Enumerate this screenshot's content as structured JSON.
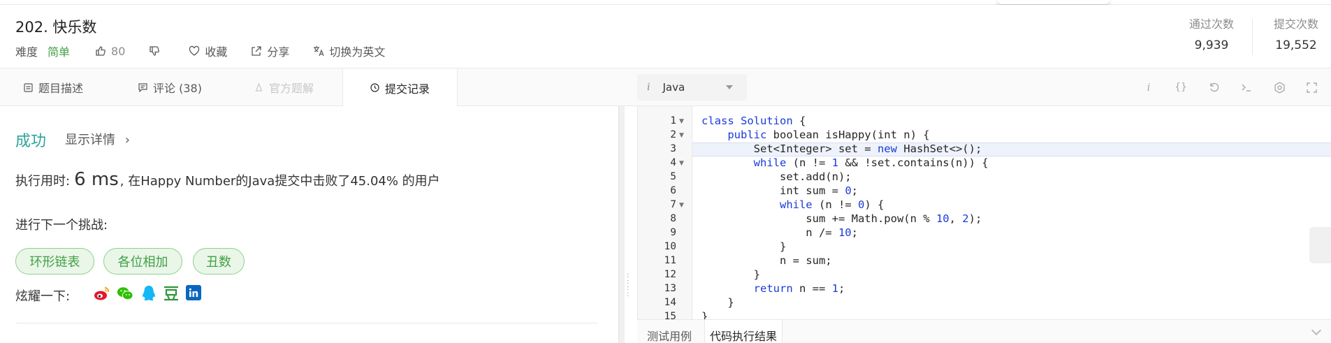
{
  "header": {
    "title": "202. 快乐数",
    "difficulty_label": "难度",
    "difficulty_value": "简单",
    "likes": "80",
    "favorite_label": "收藏",
    "share_label": "分享",
    "translate_label": "切换为英文",
    "stats": [
      {
        "label": "通过次数",
        "value": "9,939"
      },
      {
        "label": "提交次数",
        "value": "19,552"
      }
    ]
  },
  "tabs": [
    {
      "label": "题目描述",
      "icon": "description-icon",
      "state": "normal"
    },
    {
      "label": "评论 (38)",
      "icon": "comment-icon",
      "state": "normal"
    },
    {
      "label": "官方题解",
      "icon": "solution-icon",
      "state": "disabled"
    },
    {
      "label": "提交记录",
      "icon": "clock-icon",
      "state": "active"
    }
  ],
  "editor_toolbar": {
    "language": "Java",
    "icons": [
      "info-icon",
      "braces-icon",
      "reset-icon",
      "console-icon",
      "settings-icon",
      "fullscreen-icon"
    ]
  },
  "result": {
    "status": "成功",
    "details_link": "显示详情",
    "runtime_prefix": "执行用时:",
    "runtime_value": "6 ms",
    "runtime_suffix": ", 在Happy Number的Java提交中击败了45.04% 的用户",
    "challenge_label": "进行下一个挑战:",
    "challenge_tags": [
      "环形链表",
      "各位相加",
      "丑数"
    ],
    "share_label": "炫耀一下:",
    "share_icons": [
      "weibo-icon",
      "wechat-icon",
      "qq-icon",
      "douban-icon",
      "linkedin-icon"
    ],
    "colors": {
      "success": "#2ea39b",
      "tag_text": "#43a047",
      "tag_bg": "#e9f6e8",
      "keyword": "#1a3bd8"
    }
  },
  "code": {
    "line_numbers": [
      "1",
      "2",
      "3",
      "4",
      "5",
      "6",
      "7",
      "8",
      "9",
      "10",
      "11",
      "12",
      "13",
      "14",
      "15"
    ],
    "lines": [
      "class Solution {",
      "    public boolean isHappy(int n) {",
      "        Set<Integer> set = new HashSet<>();",
      "        while (n != 1 && !set.contains(n)) {",
      "            set.add(n);",
      "            int sum = 0;",
      "            while (n != 0) {",
      "                sum += Math.pow(n % 10, 2);",
      "                n /= 10;",
      "            }",
      "            n = sum;",
      "        }",
      "        return n == 1;",
      "    }",
      "}"
    ]
  },
  "console_tabs": [
    "测试用例",
    "代码执行结果"
  ]
}
